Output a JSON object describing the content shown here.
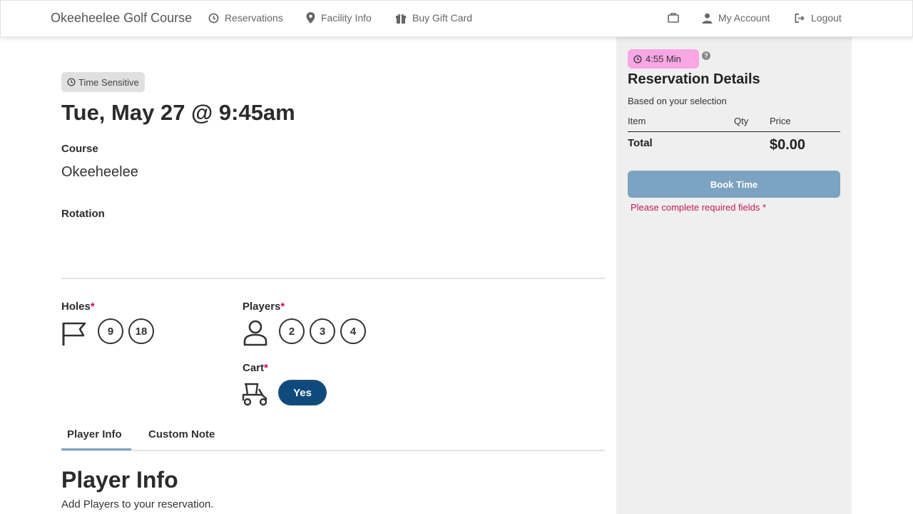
{
  "nav": {
    "brand": "Okeeheelee Golf Course",
    "reservations": "Reservations",
    "facility_info": "Facility Info",
    "buy_gift_card": "Buy Gift Card",
    "my_account": "My Account",
    "logout": "Logout"
  },
  "main": {
    "badge": "Time Sensitive",
    "date_title": "Tue, May 27 @ 9:45am",
    "course_label": "Course",
    "course_value": "Okeeheelee",
    "rotation_label": "Rotation",
    "holes_label": "Holes",
    "holes_options": [
      "9",
      "18"
    ],
    "players_label": "Players",
    "players_options": [
      "2",
      "3",
      "4"
    ],
    "cart_label": "Cart",
    "cart_option": "Yes",
    "required_mark": "*"
  },
  "tabs": {
    "player_info": "Player Info",
    "custom_note": "Custom Note"
  },
  "player_info": {
    "title": "Player Info",
    "subtitle": "Add Players to your reservation."
  },
  "sidebar": {
    "timer": "4:55 Min",
    "help": "?",
    "title": "Reservation Details",
    "subtitle": "Based on your selection",
    "col_item": "Item",
    "col_qty": "Qty",
    "col_price": "Price",
    "total_label": "Total",
    "total_value": "$0.00",
    "book_button": "Book Time",
    "required_message": "Please complete required fields *"
  },
  "colors": {
    "accent_blue": "#0f4a7c",
    "book_button_disabled": "#7ca4c2",
    "timer_pink": "#f8a6e4",
    "required_red": "#d6005a"
  }
}
